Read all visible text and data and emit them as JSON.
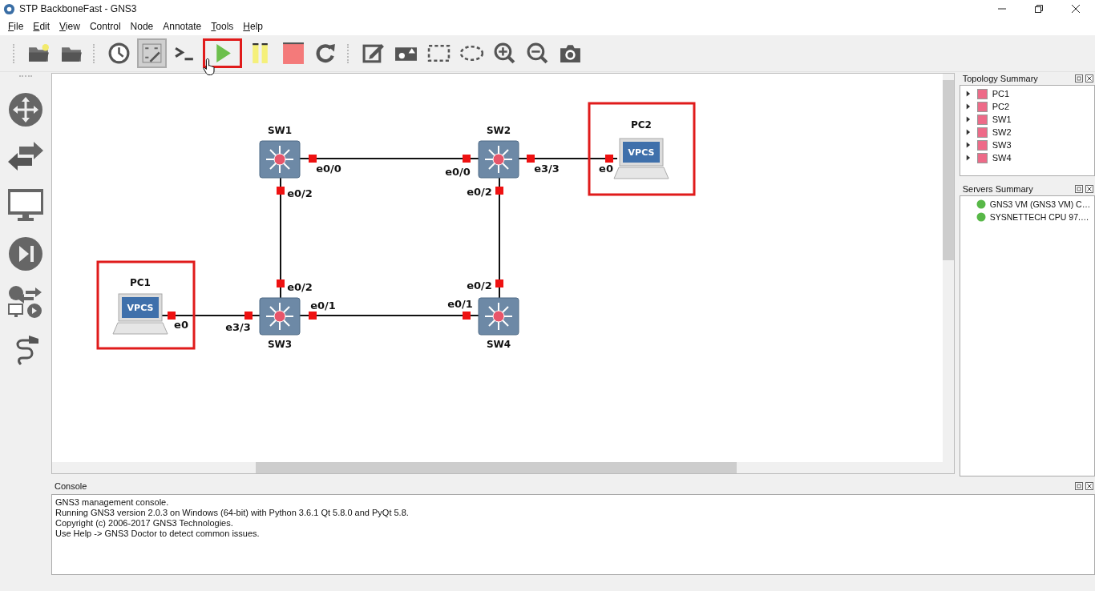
{
  "window": {
    "title": "STP BackboneFast - GNS3"
  },
  "menu": [
    {
      "label": "File",
      "mnemonic": true
    },
    {
      "label": "Edit",
      "mnemonic": true
    },
    {
      "label": "View",
      "mnemonic": true
    },
    {
      "label": "Control",
      "mnemonic": false
    },
    {
      "label": "Node",
      "mnemonic": false
    },
    {
      "label": "Annotate",
      "mnemonic": false
    },
    {
      "label": "Tools",
      "mnemonic": true
    },
    {
      "label": "Help",
      "mnemonic": true
    }
  ],
  "toolbar": [
    {
      "kind": "new-folder",
      "on": false,
      "highlighted": false
    },
    {
      "kind": "open-folder",
      "on": false,
      "highlighted": false
    },
    {
      "kind": "clock",
      "on": false,
      "highlighted": false
    },
    {
      "kind": "label-tool",
      "on": true,
      "highlighted": false
    },
    {
      "kind": "console",
      "on": false,
      "highlighted": false
    },
    {
      "kind": "play",
      "on": false,
      "highlighted": true
    },
    {
      "kind": "pause",
      "on": false,
      "highlighted": false
    },
    {
      "kind": "stop",
      "on": false,
      "highlighted": false
    },
    {
      "kind": "reload",
      "on": false,
      "highlighted": false
    },
    {
      "kind": "note",
      "on": false,
      "highlighted": false
    },
    {
      "kind": "image",
      "on": false,
      "highlighted": false
    },
    {
      "kind": "rectangle",
      "on": false,
      "highlighted": false
    },
    {
      "kind": "ellipse",
      "on": false,
      "highlighted": false
    },
    {
      "kind": "zoom-in",
      "on": false,
      "highlighted": false
    },
    {
      "kind": "zoom-out",
      "on": false,
      "highlighted": false
    },
    {
      "kind": "camera",
      "on": false,
      "highlighted": false
    }
  ],
  "nodes": [
    {
      "name": "SW1",
      "kind": "switch",
      "highlighted": false
    },
    {
      "name": "SW2",
      "kind": "switch",
      "highlighted": false
    },
    {
      "name": "SW3",
      "kind": "switch",
      "highlighted": false
    },
    {
      "name": "SW4",
      "kind": "switch",
      "highlighted": false
    },
    {
      "name": "PC1",
      "kind": "vpcs",
      "screen_label": "VPCS",
      "highlighted": true
    },
    {
      "name": "PC2",
      "kind": "vpcs",
      "screen_label": "VPCS",
      "highlighted": true
    }
  ],
  "links": [
    {
      "ports": [
        "e0/0",
        "e0/0"
      ]
    },
    {
      "ports": [
        "e3/3",
        "e0"
      ]
    },
    {
      "ports": [
        "e0/2",
        "e0/2"
      ]
    },
    {
      "ports": [
        "e0/2",
        "e0/2"
      ]
    },
    {
      "ports": [
        "e0/1",
        "e0/1"
      ]
    },
    {
      "ports": [
        "e0",
        "e3/3"
      ]
    }
  ],
  "topology_summary": {
    "title": "Topology Summary",
    "items": [
      {
        "name": "PC1",
        "expanded": false
      },
      {
        "name": "PC2",
        "expanded": false
      },
      {
        "name": "SW1",
        "expanded": false
      },
      {
        "name": "SW2",
        "expanded": false
      },
      {
        "name": "SW3",
        "expanded": false
      },
      {
        "name": "SW4",
        "expanded": false
      }
    ]
  },
  "servers_summary": {
    "title": "Servers Summary",
    "items": [
      {
        "name": "GNS3 VM (GNS3 VM) C…",
        "running": true
      },
      {
        "name": "SYSNETTECH CPU 97.…",
        "running": true
      }
    ]
  },
  "console": {
    "title": "Console",
    "lines": [
      "GNS3 management console.",
      "Running GNS3 version 2.0.3 on Windows (64-bit) with Python 3.6.1 Qt 5.8.0 and PyQt 5.8.",
      "Copyright (c) 2006-2017 GNS3 Technologies.",
      "Use Help -> GNS3 Doctor to detect common issues."
    ]
  }
}
